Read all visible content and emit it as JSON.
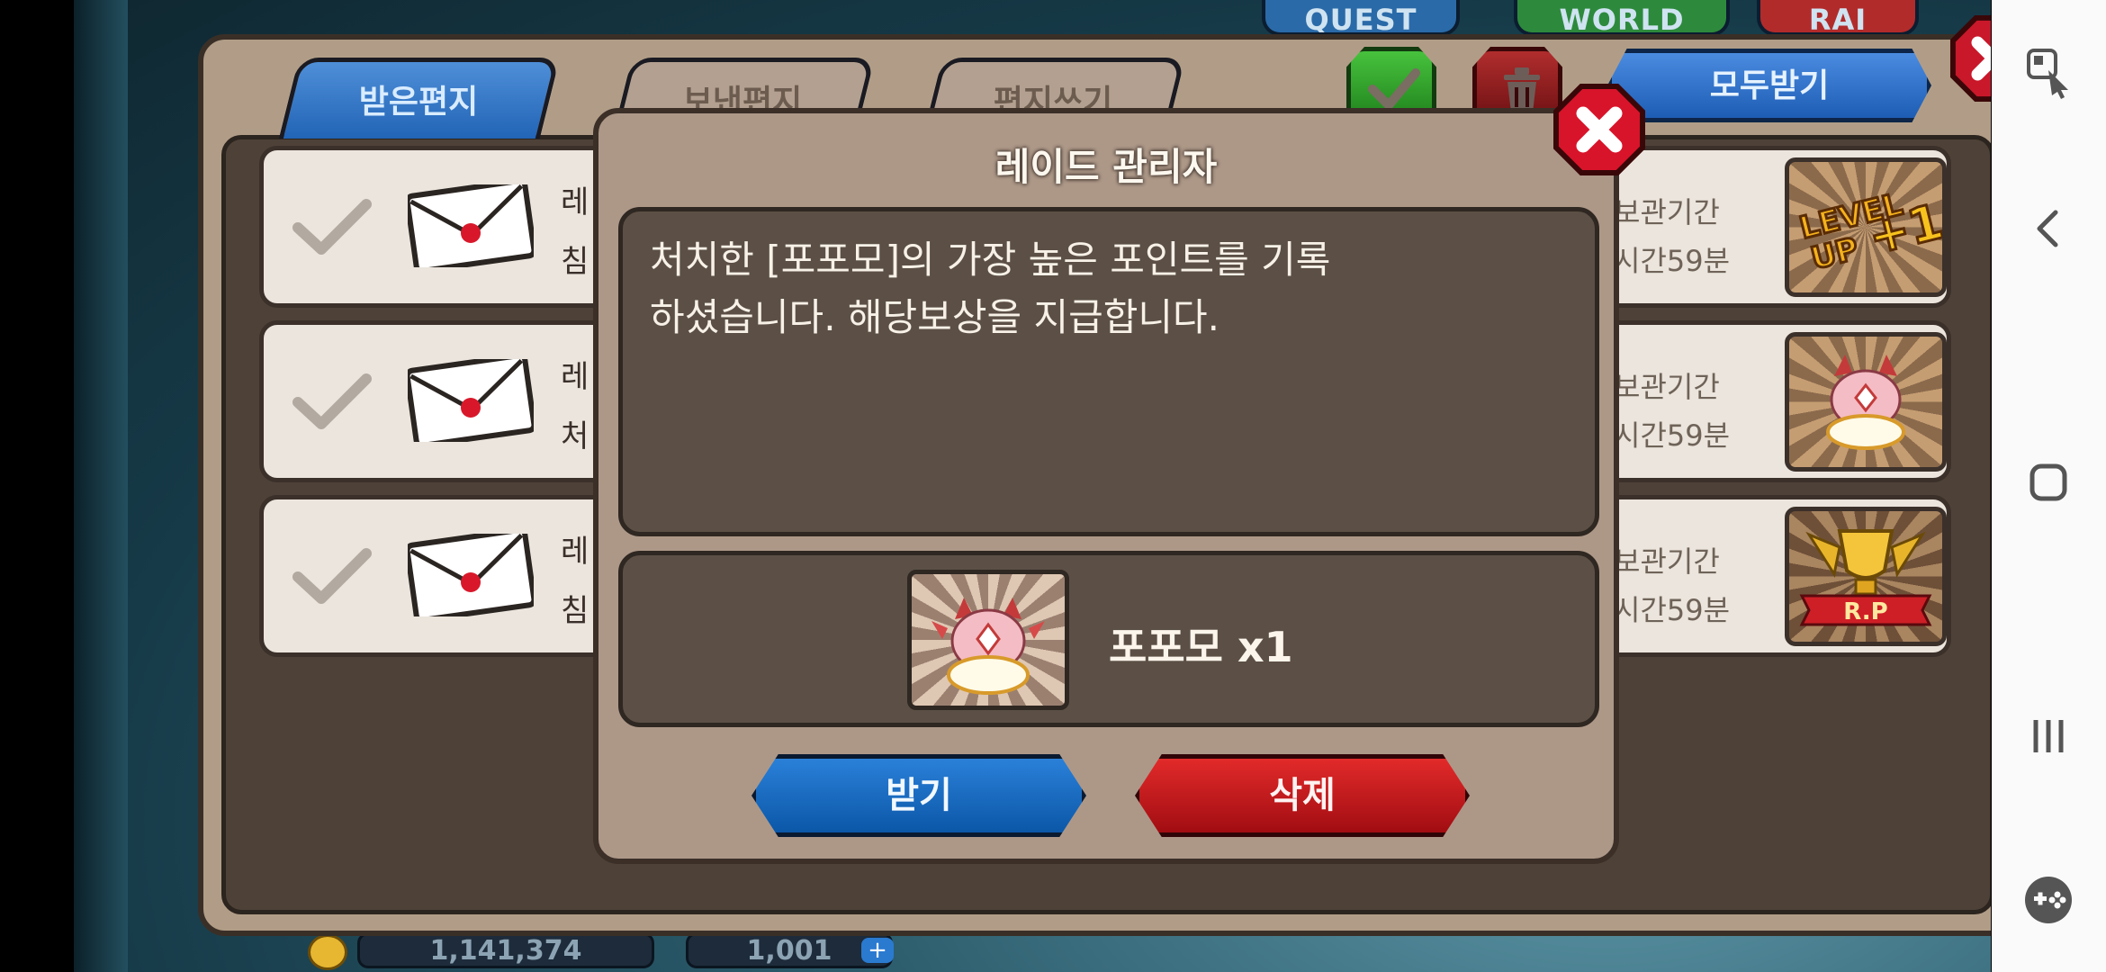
{
  "top_buttons": {
    "quest": "QUEST",
    "world": "WORLD",
    "raid": "RAI"
  },
  "mailbox": {
    "tabs": {
      "received": "받은편지",
      "sent": "보낸편지",
      "write": "편지쓰기"
    },
    "receive_all_label": "모두받기",
    "rows": [
      {
        "sender": "레",
        "subject": "침",
        "period": "보관기간",
        "remaining": "시간59분",
        "reward_icon": "level-up-icon"
      },
      {
        "sender": "레",
        "subject": "처",
        "period": "보관기간",
        "remaining": "시간59분",
        "reward_icon": "popomo-icon"
      },
      {
        "sender": "레",
        "subject": "침",
        "period": "보관기간",
        "remaining": "시간59분",
        "reward_icon": "raid-point-trophy-icon"
      }
    ]
  },
  "reward_icons": {
    "level_up_line1": "LEVEL",
    "level_up_line2": "UP",
    "level_up_num": "+1",
    "rp": "R.P"
  },
  "dialog": {
    "title": "레이드 관리자",
    "message": "처치한 [포포모]의 가장 높은 포인트를 기록\n하셨습니다. 해당보상을 지급합니다.",
    "item_name": "포포모 x1",
    "receive_label": "받기",
    "delete_label": "삭제"
  },
  "bottom_bar": {
    "gold": "1,141,374",
    "gems": "1,001",
    "gem_plus": "+"
  },
  "colors": {
    "accent_blue": "#1e5db4",
    "accent_red": "#c01a1e",
    "panel": "#ad9888",
    "nav_bg": "#fafafa"
  },
  "navbar": {
    "icons": [
      "screen-pin-icon",
      "back-icon",
      "home-icon",
      "recent-apps-icon",
      "game-launcher-icon"
    ]
  }
}
